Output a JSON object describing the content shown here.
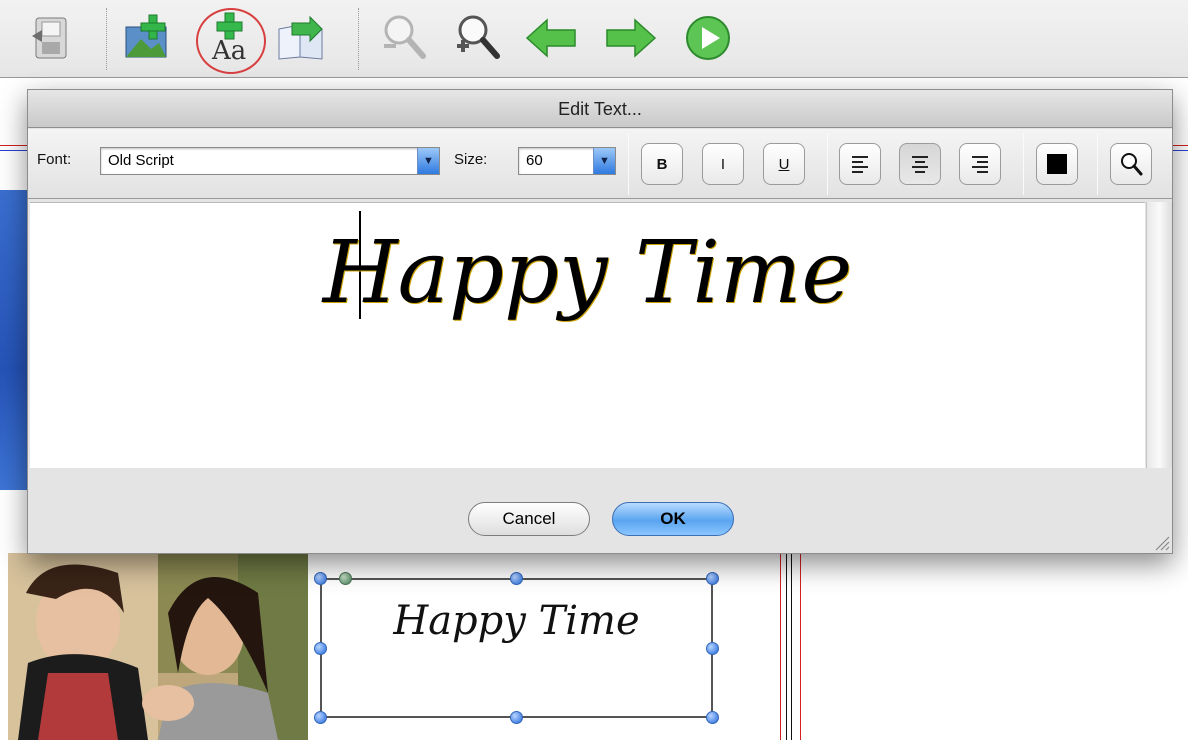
{
  "toolbar": {
    "buttons": [
      {
        "name": "save-icon"
      },
      {
        "name": "add-image-icon"
      },
      {
        "name": "add-text-icon",
        "glyph": "Aa"
      },
      {
        "name": "import-page-icon"
      },
      {
        "name": "zoom-out-icon"
      },
      {
        "name": "zoom-in-icon"
      },
      {
        "name": "back-arrow-icon"
      },
      {
        "name": "forward-arrow-icon"
      },
      {
        "name": "play-icon"
      }
    ]
  },
  "dialog": {
    "title": "Edit Text...",
    "font_label": "Font:",
    "font_value": "Old Script",
    "size_label": "Size:",
    "size_value": "60",
    "bold_label": "B",
    "italic_label": "I",
    "underline_label": "U",
    "alignment_selected": "center",
    "text_color": "#000000",
    "editor_text": "Happy Time",
    "cancel_label": "Cancel",
    "ok_label": "OK"
  },
  "canvas": {
    "frame_text": "Happy Time",
    "guide_colors": {
      "red": "#d32020",
      "blue": "#2a3fd6"
    }
  }
}
